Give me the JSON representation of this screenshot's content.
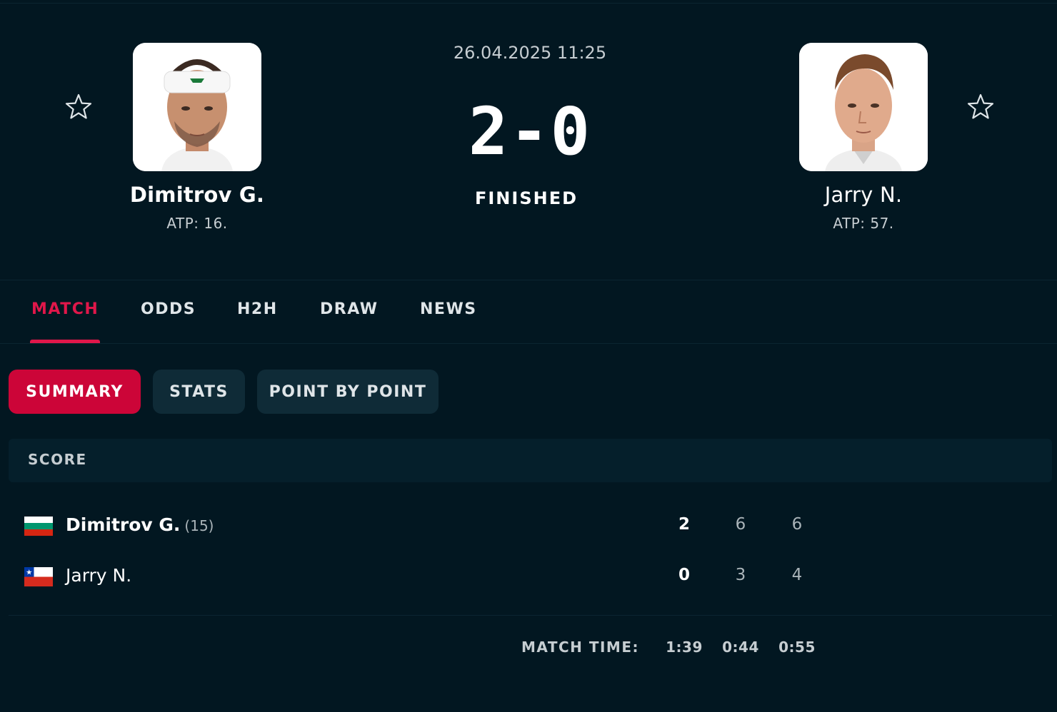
{
  "match": {
    "datetime": "26.04.2025 11:25",
    "score": "2-0",
    "status": "FINISHED"
  },
  "home": {
    "name": "Dimitrov G.",
    "rank": "ATP: 16.",
    "seed": "(15)",
    "country_flag": "bulgaria-flag",
    "sets_won": "2",
    "set_scores": [
      "6",
      "6"
    ]
  },
  "away": {
    "name": "Jarry N.",
    "rank": "ATP: 57.",
    "country_flag": "chile-flag",
    "sets_won": "0",
    "set_scores": [
      "3",
      "4"
    ]
  },
  "tabs": [
    {
      "label": "MATCH",
      "active": true
    },
    {
      "label": "ODDS",
      "active": false
    },
    {
      "label": "H2H",
      "active": false
    },
    {
      "label": "DRAW",
      "active": false
    },
    {
      "label": "NEWS",
      "active": false
    }
  ],
  "subtabs": [
    {
      "label": "SUMMARY",
      "active": true
    },
    {
      "label": "STATS",
      "active": false
    },
    {
      "label": "POINT BY POINT",
      "active": false
    }
  ],
  "score_section": {
    "title": "SCORE",
    "match_time_label": "MATCH TIME:",
    "match_times": [
      "1:39",
      "0:44",
      "0:55"
    ]
  },
  "colors": {
    "background": "#021721",
    "accent": "#e0174a",
    "pill": "#0f2b37",
    "pill_active": "#cc0538"
  },
  "icons": {
    "favorite": "star-outline-icon"
  }
}
